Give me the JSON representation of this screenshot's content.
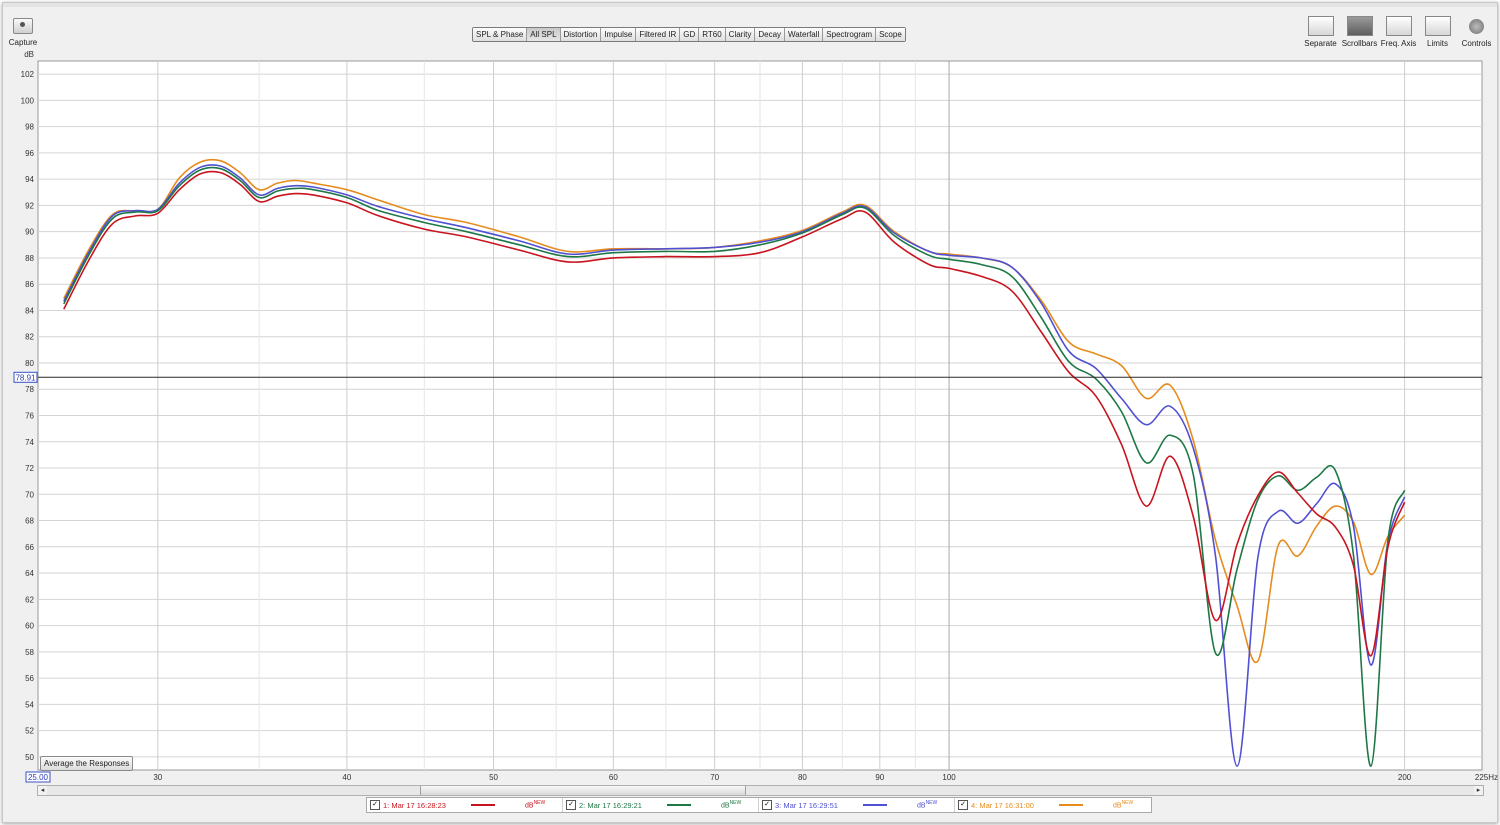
{
  "capture": {
    "label": "Capture",
    "icon": "camera-icon"
  },
  "tabs": [
    "SPL & Phase",
    "All SPL",
    "Distortion",
    "Impulse",
    "Filtered IR",
    "GD",
    "RT60",
    "Clarity",
    "Decay",
    "Waterfall",
    "Spectrogram",
    "Scope"
  ],
  "active_tab": "All SPL",
  "toolbar": {
    "separate": "Separate",
    "scrollbars": "Scrollbars",
    "freq_axis": "Freq. Axis",
    "limits": "Limits",
    "controls": "Controls"
  },
  "average_button": "Average the Responses",
  "cursor_level": "78.91",
  "x_start": "25.00",
  "x_end": "225Hz",
  "colors": {
    "red": "#c8141e",
    "green": "#1e7846",
    "blue": "#5050d2",
    "orange": "#e68c1e",
    "cursor": "#2a2a2a"
  },
  "chart_data": {
    "type": "line",
    "ylabel": "dB",
    "ylim": [
      49,
      103
    ],
    "xlim": [
      25,
      225
    ],
    "xscale": "log",
    "yticks": [
      50,
      52,
      54,
      56,
      58,
      60,
      62,
      64,
      66,
      68,
      70,
      72,
      74,
      76,
      78,
      80,
      82,
      84,
      86,
      88,
      90,
      92,
      94,
      96,
      98,
      100,
      102
    ],
    "xticks": [
      30,
      40,
      50,
      60,
      70,
      80,
      90,
      100,
      200
    ],
    "minor_xticks": [
      35,
      45,
      55,
      65,
      75,
      85,
      95
    ],
    "cursor_y": 78.91,
    "x": [
      26,
      27,
      28,
      29,
      30,
      31,
      32,
      33,
      34,
      35,
      36,
      37,
      38,
      40,
      42,
      45,
      48,
      52,
      56,
      60,
      65,
      70,
      75,
      80,
      85,
      88,
      92,
      97,
      100,
      105,
      110,
      115,
      120,
      125,
      130,
      135,
      140,
      145,
      150,
      155,
      160,
      165,
      170,
      175,
      180,
      185,
      190,
      195,
      200
    ],
    "series": [
      {
        "name": "1: Mar 17 16:28:23",
        "color": "#c8141e",
        "unit": "dB",
        "unit_tag": "NEW",
        "values": [
          84.1,
          87.8,
          90.6,
          91.2,
          91.4,
          93.2,
          94.4,
          94.5,
          93.6,
          92.3,
          92.7,
          92.9,
          92.8,
          92.2,
          91.2,
          90.2,
          89.6,
          88.6,
          87.7,
          88.0,
          88.1,
          88.1,
          88.4,
          89.6,
          91.0,
          91.5,
          89.2,
          87.5,
          87.2,
          86.6,
          85.5,
          82.4,
          79.3,
          77.5,
          73.8,
          69.1,
          72.9,
          68.3,
          60.4,
          66.2,
          69.9,
          71.7,
          70.1,
          68.5,
          67.5,
          64.6,
          57.7,
          66.0,
          69.4
        ]
      },
      {
        "name": "2: Mar 17 16:29:21",
        "color": "#1e7846",
        "unit": "dB",
        "unit_tag": "NEW",
        "values": [
          84.5,
          88.2,
          91.0,
          91.5,
          91.6,
          93.5,
          94.7,
          94.8,
          93.9,
          92.6,
          93.1,
          93.3,
          93.2,
          92.6,
          91.6,
          90.7,
          90.0,
          89.0,
          88.1,
          88.4,
          88.5,
          88.5,
          89.0,
          89.9,
          91.3,
          91.8,
          89.7,
          88.2,
          87.9,
          87.5,
          86.6,
          83.5,
          80.1,
          78.8,
          76.3,
          72.4,
          74.5,
          71.5,
          57.9,
          64.3,
          69.6,
          71.4,
          70.3,
          71.3,
          71.8,
          65.4,
          49.3,
          66.5,
          70.3
        ]
      },
      {
        "name": "3: Mar 17 16:29:51",
        "color": "#5050d2",
        "unit": "dB",
        "unit_tag": "NEW",
        "values": [
          84.7,
          88.4,
          91.2,
          91.6,
          91.7,
          93.7,
          94.9,
          95.0,
          94.1,
          92.8,
          93.3,
          93.5,
          93.4,
          92.8,
          91.9,
          91.0,
          90.3,
          89.3,
          88.3,
          88.6,
          88.7,
          88.8,
          89.2,
          90.0,
          91.4,
          91.9,
          89.9,
          88.5,
          88.2,
          88.0,
          87.3,
          84.6,
          80.9,
          79.6,
          77.3,
          75.3,
          76.7,
          73.5,
          65.3,
          49.3,
          65.2,
          68.7,
          67.8,
          69.3,
          70.8,
          67.6,
          57.0,
          66.4,
          69.8
        ]
      },
      {
        "name": "4: Mar 17 16:31:00",
        "color": "#e68c1e",
        "unit": "dB",
        "unit_tag": "NEW",
        "values": [
          84.9,
          88.6,
          91.3,
          91.6,
          91.7,
          94.1,
          95.3,
          95.4,
          94.5,
          93.2,
          93.7,
          93.9,
          93.7,
          93.2,
          92.4,
          91.3,
          90.7,
          89.6,
          88.5,
          88.7,
          88.7,
          88.8,
          89.3,
          90.1,
          91.5,
          92.0,
          90.0,
          88.5,
          88.3,
          88.0,
          87.3,
          84.8,
          81.6,
          80.7,
          79.8,
          77.3,
          78.3,
          74.1,
          66.5,
          61.5,
          57.3,
          66.1,
          65.3,
          67.6,
          69.1,
          67.9,
          63.9,
          66.8,
          68.4
        ]
      }
    ]
  }
}
